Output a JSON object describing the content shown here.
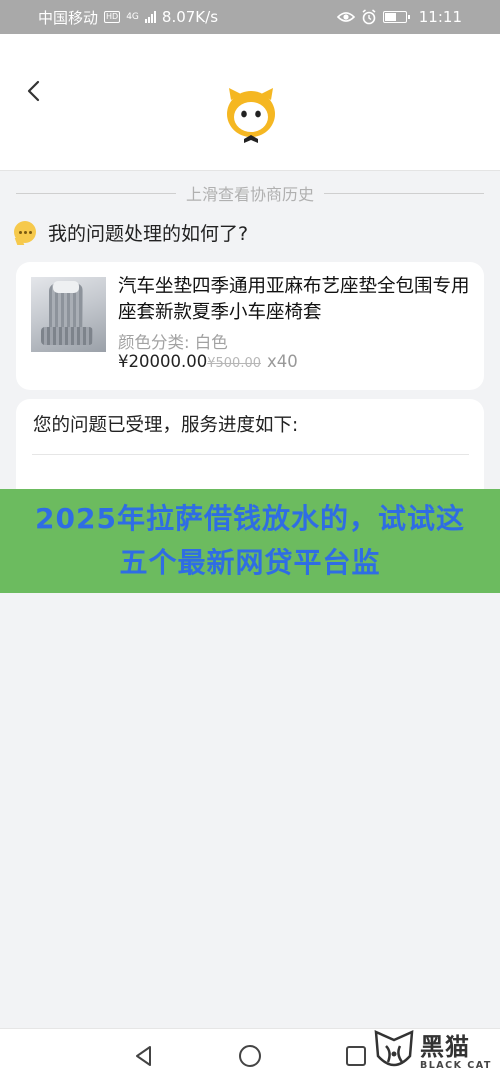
{
  "status_bar": {
    "carrier": "中国移动",
    "hd_badge": "HD",
    "network": "4G",
    "speed": "8.07K/s",
    "time": "11:11",
    "icons": [
      "eye-icon",
      "alarm-icon",
      "battery-icon"
    ]
  },
  "header": {
    "back_icon": "chevron-left-icon",
    "logo_icon": "mascot-logo-icon"
  },
  "history": {
    "label": "上滑查看协商历史"
  },
  "question": {
    "icon": "chat-bubble-icon",
    "text": "我的问题处理的如何了?"
  },
  "product": {
    "title": "汽车坐垫四季通用亚麻布艺座垫全包围专用座套新款夏季小车座椅套",
    "variant": "颜色分类: 白色",
    "price": "¥20000.00",
    "original_price": "¥500.00",
    "quantity": "x40"
  },
  "progress": {
    "text": "您的问题已受理，服务进度如下:"
  },
  "banner": {
    "text": "2025年拉萨借钱放水的，试试这五个最新网贷平台监"
  },
  "nav_bar": {
    "icons": [
      "triangle-back-icon",
      "circle-home-icon",
      "square-recent-icon"
    ]
  },
  "watermark": {
    "brand_cn": "黑猫",
    "brand_en": "BLACK CAT"
  },
  "colors": {
    "status_bar_bg": "#a9a9a9",
    "page_bg": "#f2f3f5",
    "banner_bg": "#6cbb5f",
    "banner_text": "#2f6de4",
    "mascot_yellow": "#f5b722"
  }
}
